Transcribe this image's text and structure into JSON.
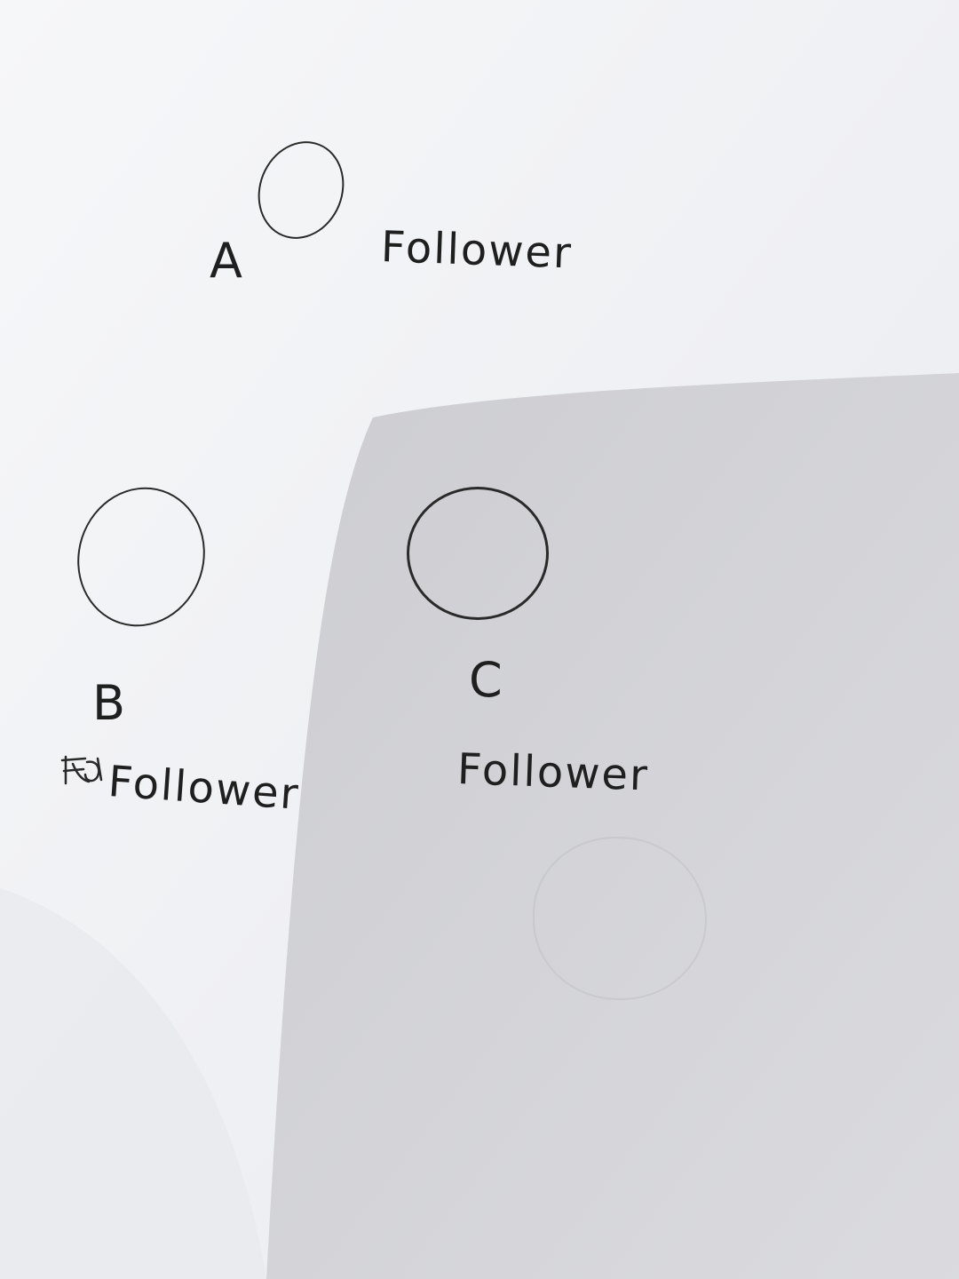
{
  "nodes": [
    {
      "id": "A",
      "label": "A",
      "role": "Follower"
    },
    {
      "id": "B",
      "label": "B",
      "role": "Follower"
    },
    {
      "id": "C",
      "label": "C",
      "role": "Follower"
    }
  ],
  "colors": {
    "ink": "#2a2a2a",
    "paper_light": "#f4f5f7",
    "shadow": "#c9c9ce"
  }
}
